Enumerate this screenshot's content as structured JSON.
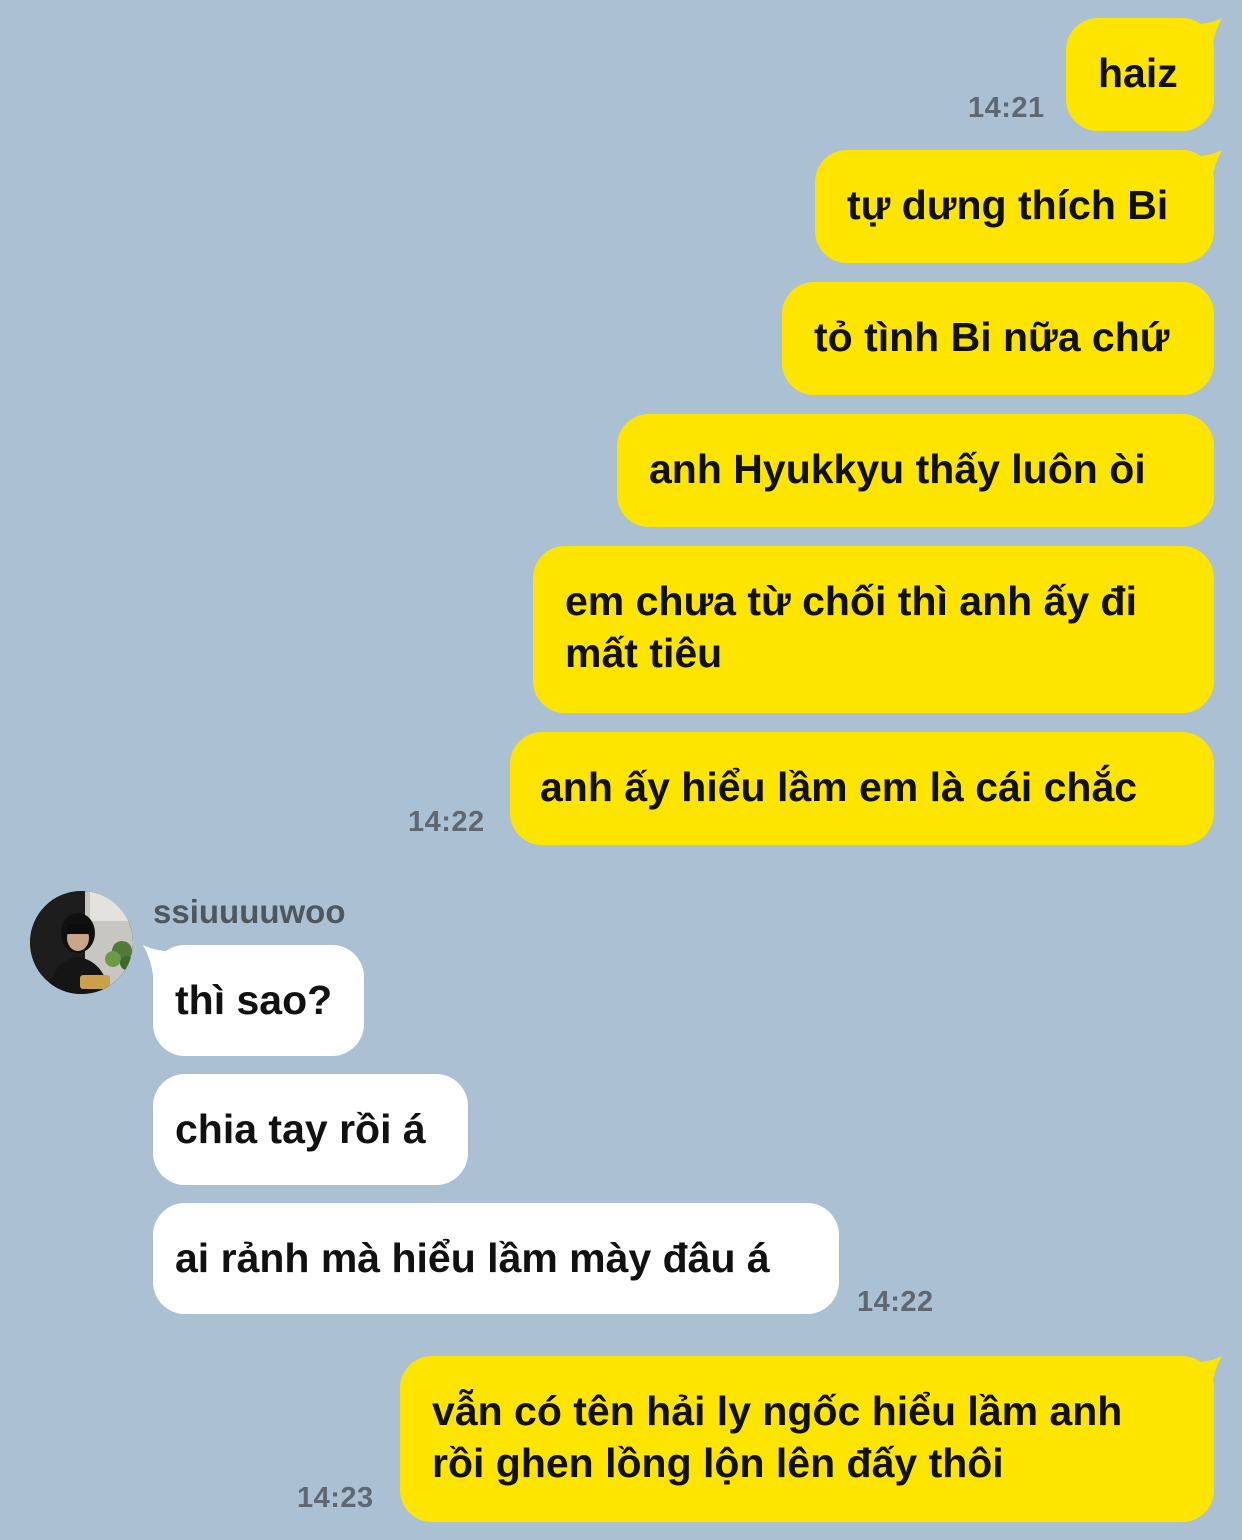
{
  "contact": {
    "name": "ssiuuuuwoo",
    "avatar": "profile-photo"
  },
  "colors": {
    "background": "#abc1d3",
    "outgoing_bubble": "#fee500",
    "incoming_bubble": "#ffffff",
    "timestamp": "#5f6770"
  },
  "messages": [
    {
      "direction": "out",
      "text": "haiz",
      "time": "14:21"
    },
    {
      "direction": "out",
      "text": "tự dưng thích Bi"
    },
    {
      "direction": "out",
      "text": "tỏ tình Bi nữa chứ"
    },
    {
      "direction": "out",
      "text": "anh Hyukkyu thấy luôn òi"
    },
    {
      "direction": "out",
      "text": "em chưa từ chối thì anh ấy đi mất tiêu"
    },
    {
      "direction": "out",
      "text": "anh ấy hiểu lầm em là cái chắc",
      "time": "14:22"
    },
    {
      "direction": "in",
      "text": "thì sao?"
    },
    {
      "direction": "in",
      "text": "chia tay rồi á"
    },
    {
      "direction": "in",
      "text": "ai rảnh mà hiểu lầm mày đâu á",
      "time": "14:22"
    },
    {
      "direction": "out",
      "text": "vẫn có tên hải ly ngốc hiểu lầm anh rồi ghen lồng lộn lên đấy thôi",
      "time": "14:23"
    }
  ]
}
